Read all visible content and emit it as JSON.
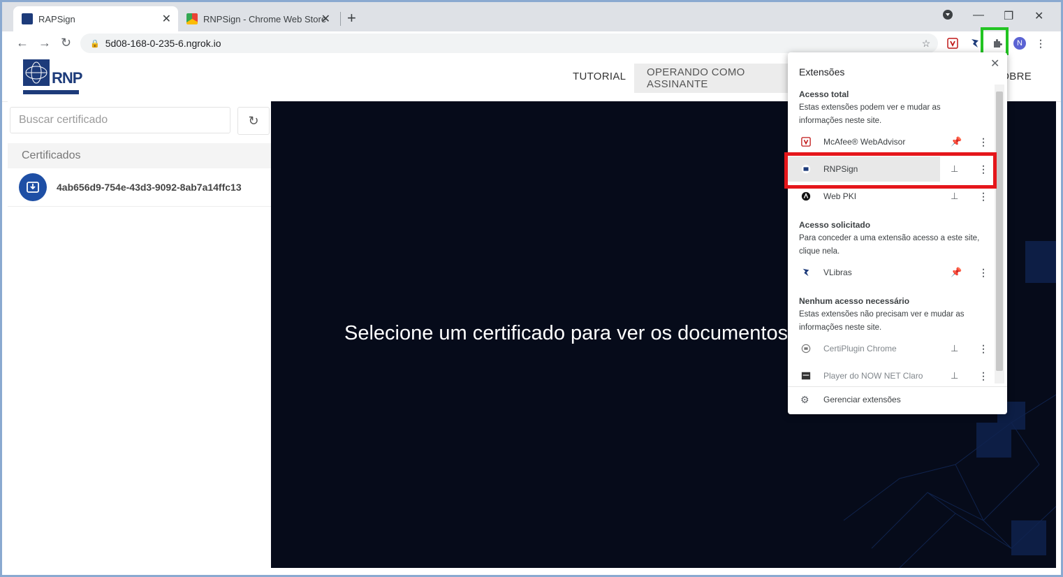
{
  "browser": {
    "tabs": [
      {
        "label": "RAPSign",
        "close": "✕"
      },
      {
        "label": "RNPSign - Chrome Web Store",
        "close": "✕"
      }
    ],
    "new_tab": "+",
    "url": "5d08-168-0-235-6.ngrok.io",
    "window_controls": {
      "minimize": "—",
      "restore": "❐",
      "close": "✕"
    },
    "profile_initial": "N"
  },
  "header": {
    "logo_text": "RNP",
    "nav": [
      {
        "label": "TUTORIAL"
      },
      {
        "label": "OPERANDO COMO ASSINANTE"
      },
      {
        "label": "SOBRE"
      }
    ]
  },
  "sidebar": {
    "search_placeholder": "Buscar certificado",
    "section_title": "Certificados",
    "certificates": [
      {
        "id": "4ab656d9-754e-43d3-9092-8ab7a14ffc13"
      }
    ]
  },
  "main": {
    "message": "Selecione um certificado para ver os documentos"
  },
  "extensions_popup": {
    "title": "Extensões",
    "sections": [
      {
        "heading": "Acesso total",
        "description": "Estas extensões podem ver e mudar as informações neste site.",
        "items": [
          {
            "name": "McAfee® WebAdvisor",
            "pinned": true
          },
          {
            "name": "RNPSign",
            "pinned": false
          },
          {
            "name": "Web PKI",
            "pinned": false
          }
        ]
      },
      {
        "heading": "Acesso solicitado",
        "description": "Para conceder a uma extensão acesso a este site, clique nela.",
        "items": [
          {
            "name": "VLibras",
            "pinned": true
          }
        ]
      },
      {
        "heading": "Nenhum acesso necessário",
        "description": "Estas extensões não precisam ver e mudar as informações neste site.",
        "items": [
          {
            "name": "CertiPlugin Chrome",
            "pinned": false
          },
          {
            "name": "Player do NOW NET Claro",
            "pinned": false
          }
        ]
      }
    ],
    "manage_label": "Gerenciar extensões"
  },
  "colors": {
    "pin_active": "#1a73e8",
    "highlight_green": "#22c422",
    "highlight_red": "#e5161b",
    "main_bg": "#060b1a",
    "cert_icon": "#1e4fa5"
  }
}
